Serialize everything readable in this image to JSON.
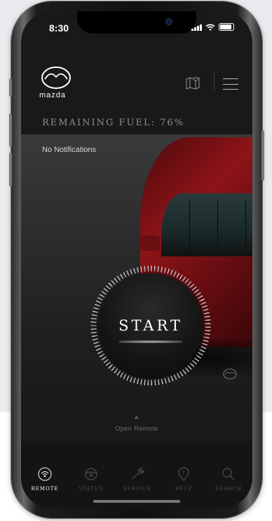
{
  "status_bar": {
    "time": "8:30"
  },
  "brand": {
    "name": "mazda"
  },
  "fuel": {
    "text": "REMAINING FUEL: 76%"
  },
  "notifications": {
    "text": "No Notifications"
  },
  "start": {
    "label": "START"
  },
  "open_remote": {
    "label": "Open Remote"
  },
  "tabs": [
    {
      "label": "REMOTE",
      "icon": "remote-icon",
      "active": true
    },
    {
      "label": "STATUS",
      "icon": "steering-wheel-icon",
      "active": false
    },
    {
      "label": "SERVICE",
      "icon": "wrench-icon",
      "active": false
    },
    {
      "label": "HELP",
      "icon": "help-pin-icon",
      "active": false
    },
    {
      "label": "SEARCH",
      "icon": "search-icon",
      "active": false
    }
  ],
  "colors": {
    "accent": "#8d1418",
    "active_tab": "#ffffff",
    "inactive_tab": "#4f4f4f"
  }
}
